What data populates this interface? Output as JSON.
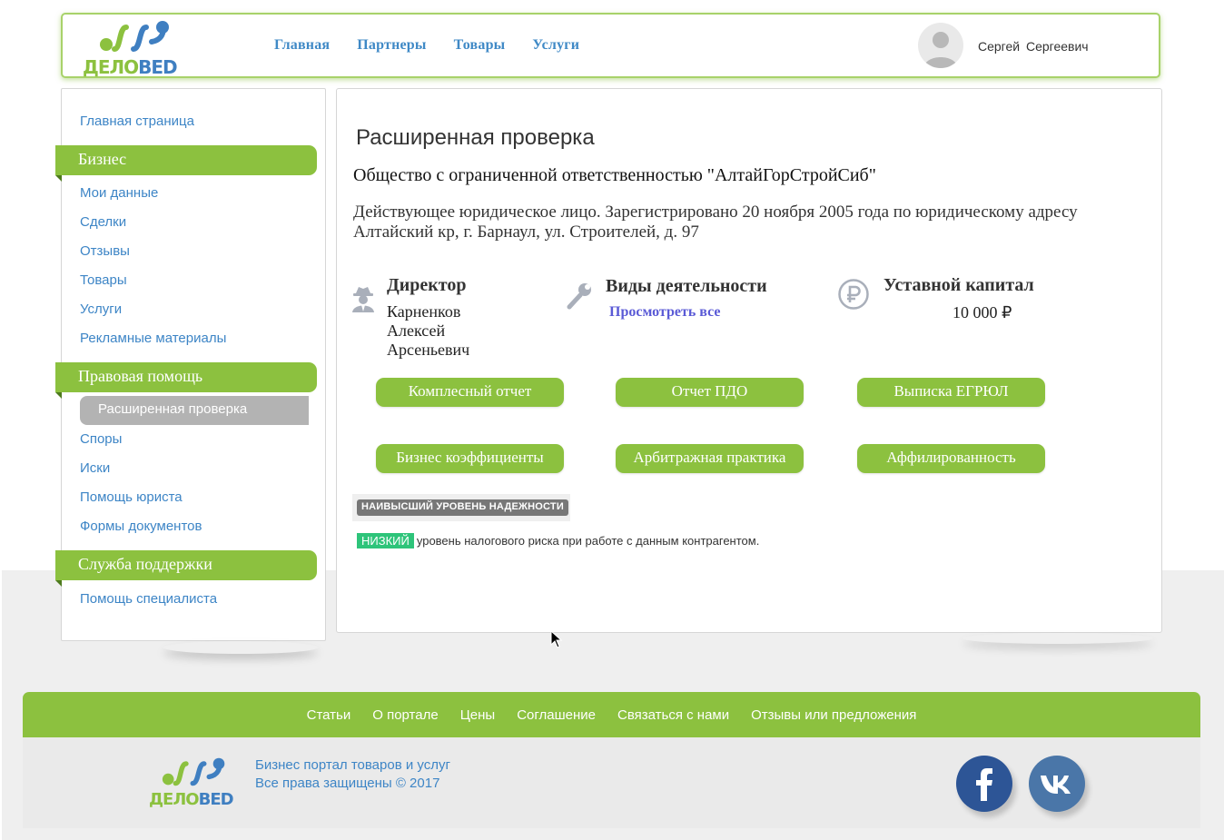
{
  "header": {
    "logo_text_green": "ДЕЛО",
    "logo_text_blue": "BED",
    "nav": [
      "Главная",
      "Партнеры",
      "Товары",
      "Услуги"
    ],
    "user_name": "Сергей Сергеевич",
    "avatar_icon": "user-avatar-icon"
  },
  "sidebar": {
    "home": "Главная страница",
    "sections": [
      {
        "title": "Бизнес",
        "items": [
          "Мои данные",
          "Сделки",
          "Отзывы",
          "Товары",
          "Услуги",
          "Рекламные материалы"
        ]
      },
      {
        "title": "Правовая помощь",
        "items": [
          "Расширенная проверка",
          "Споры",
          "Иски",
          "Помощь юриста",
          "Формы документов"
        ]
      },
      {
        "title": "Служба поддержки",
        "items": [
          "Помощь специалиста"
        ]
      }
    ],
    "active_item": "Расширенная проверка"
  },
  "main": {
    "title": "Расширенная проверка",
    "company": "Общество с ограниченной ответственностью \"АлтайГорСтройСиб\"",
    "description": "Действующее юридическое лицо. Зарегистрировано 20 ноября 2005 года по юридическому адресу Алтайский кр, г. Барнаул, ул. Строителей, д. 97",
    "director": {
      "title": "Директор",
      "lines": [
        "Карненков",
        "Алексей",
        "Арсеньевич"
      ],
      "icon": "spy-icon"
    },
    "activities": {
      "title": "Виды деятельности",
      "link": "Просмотреть все",
      "icon": "wrench-icon"
    },
    "capital": {
      "title": "Уставной капитал",
      "value": "10 000 ₽",
      "icon": "ruble-icon"
    },
    "buttons": [
      "Комплесный отчет",
      "Отчет ПДО",
      "Выписка ЕГРЮЛ",
      "Бизнес коэффициенты",
      "Арбитражная практика",
      "Аффилированность"
    ],
    "reliability_badge": "НАИВЫСШИЙ УРОВЕНЬ НАДЕЖНОСТИ",
    "risk_tag": "НИЗКИЙ",
    "risk_text": "уровень налогового риска при работе с данным контрагентом."
  },
  "footer": {
    "links": [
      "Статьи",
      "О портале",
      "Цены",
      "Соглашение",
      "Связаться с нами",
      "Отзывы или предложения"
    ],
    "tagline": "Бизнес портал товаров и услуг",
    "copyright": "Все права защищены © 2017",
    "social": [
      "facebook-icon",
      "vk-icon"
    ]
  },
  "colors": {
    "accent_green": "#8cc13f",
    "link_blue": "#3d85c6",
    "social_blue": "#2d5596",
    "risk_green": "#2ec47a"
  }
}
